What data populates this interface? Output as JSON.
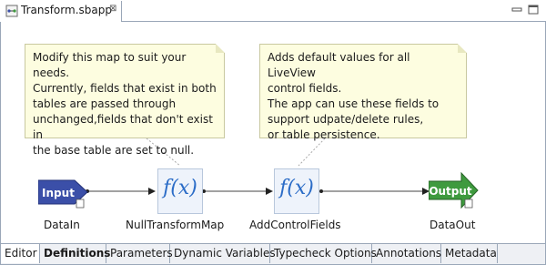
{
  "editor_tab": {
    "title": "Transform.sbapp",
    "close_glyph": "⊠"
  },
  "notes": [
    {
      "text": "Modify this map to suit your needs.\nCurrently, fields that exist in both\ntables are passed through\nunchanged,fields that don't exist in\nthe base table are set to null."
    },
    {
      "text": "Adds default values for all LiveView\ncontrol fields.\nThe app can use these fields to\nsupport udpate/delete rules,\nor table persistence."
    }
  ],
  "nodes": {
    "input": {
      "shape_text": "Input",
      "label": "DataIn",
      "color": "#3b4fa8"
    },
    "map1": {
      "symbol": "f(x)",
      "label": "NullTransformMap"
    },
    "map2": {
      "symbol": "f(x)",
      "label": "AddControlFields"
    },
    "output": {
      "shape_text": "Output",
      "label": "DataOut",
      "color": "#3e9a3e"
    }
  },
  "bottom_tabs": [
    "Editor",
    "Definitions",
    "Parameters",
    "Dynamic Variables",
    "Typecheck Options",
    "Annotations",
    "Metadata"
  ],
  "active_bottom_tab": "Editor"
}
